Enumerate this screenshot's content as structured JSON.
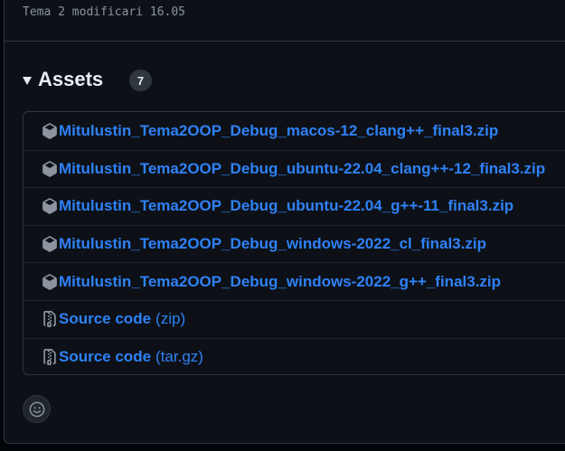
{
  "commit_message": "Tema 2 modificari 16.05",
  "assets": {
    "title": "Assets",
    "count": "7",
    "items": [
      {
        "name": "Mitulustin_Tema2OOP_Debug_macos-12_clang++_final3.zip",
        "icon": "package-icon"
      },
      {
        "name": "Mitulustin_Tema2OOP_Debug_ubuntu-22.04_clang++-12_final3.zip",
        "icon": "package-icon"
      },
      {
        "name": "Mitulustin_Tema2OOP_Debug_ubuntu-22.04_g++-11_final3.zip",
        "icon": "package-icon"
      },
      {
        "name": "Mitulustin_Tema2OOP_Debug_windows-2022_cl_final3.zip",
        "icon": "package-icon"
      },
      {
        "name": "Mitulustin_Tema2OOP_Debug_windows-2022_g++_final3.zip",
        "icon": "package-icon"
      }
    ],
    "source_items": [
      {
        "name": "Source code",
        "ext": "(zip)",
        "icon": "file-zip-icon"
      },
      {
        "name": "Source code",
        "ext": "(tar.gz)",
        "icon": "file-zip-icon"
      }
    ]
  },
  "reaction_icon": "smiley-icon",
  "colors": {
    "link": "#2f81f7",
    "background": "#0d1117",
    "border": "#30363d"
  }
}
